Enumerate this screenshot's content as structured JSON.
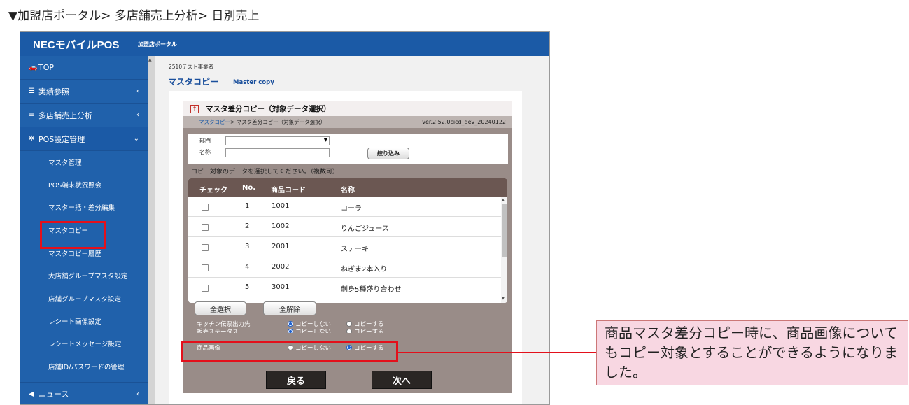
{
  "caption": "▼加盟店ポータル> 多店舗売上分析> 日別売上",
  "app": {
    "brand": "NECモバイルPOS",
    "brand_sub": "加盟店ポータル"
  },
  "sidebar": {
    "top_items": [
      {
        "icon": "car-icon",
        "label": "TOP",
        "chevron": ""
      },
      {
        "icon": "list-icon",
        "label": "実績参照",
        "chevron": "‹"
      },
      {
        "icon": "database-icon",
        "label": "多店舗売上分析",
        "chevron": "‹"
      },
      {
        "icon": "gear-icon",
        "label": "POS設定管理",
        "chevron": "⌄"
      }
    ],
    "sub_items": [
      "マスタ管理",
      "POS端末状況照会",
      "マスター括・差分編集",
      "マスタコピー",
      "マスタコピー履歴",
      "大店舗グループマスタ設定",
      "店舗グループマスタ設定",
      "レシート画像設定",
      "レシートメッセージ設定",
      "店舗ID/パスワードの管理"
    ],
    "bottom_item": {
      "icon": "megaphone-icon",
      "label": "ニュース",
      "chevron": "‹"
    }
  },
  "content": {
    "company": "2510テスト事業者",
    "page_title": "マスタコピー",
    "page_title_en": "Master copy"
  },
  "dialog": {
    "title": "マスタ差分コピー（対象データ選択）",
    "breadcrumb_link": "マスタコピー",
    "breadcrumb_rest": " > マスタ差分コピー（対象データ選択）",
    "version": "ver.2.52.0cicd_dev_20240122",
    "filter": {
      "dept_label": "部門",
      "name_label": "名称",
      "dept_value": "",
      "name_value": "",
      "search_button": "絞り込み"
    },
    "select_note": "コピー対象のデータを選択してください。（複数可）",
    "table": {
      "headers": [
        "チェック",
        "No.",
        "商品コード",
        "名称"
      ],
      "rows": [
        {
          "no": "1",
          "code": "1001",
          "name": "コーラ"
        },
        {
          "no": "2",
          "code": "1002",
          "name": "りんごジュース"
        },
        {
          "no": "3",
          "code": "2001",
          "name": "ステーキ"
        },
        {
          "no": "4",
          "code": "2002",
          "name": "ねぎま2本入り"
        },
        {
          "no": "5",
          "code": "3001",
          "name": "刺身5種盛り合わせ"
        }
      ]
    },
    "select_all": "全選択",
    "clear_all": "全解除",
    "options": [
      {
        "label": "キッチン伝票出力先",
        "no_copy": "コピーしない",
        "copy": "コピーする",
        "selected": "no_copy"
      },
      {
        "label": "販売ステータス",
        "no_copy": "コピーしない",
        "copy": "コピーする",
        "selected": "no_copy"
      },
      {
        "label": "商品画像",
        "no_copy": "コピーしない",
        "copy": "コピーする",
        "selected": "copy"
      }
    ],
    "back_button": "戻る",
    "next_button": "次へ"
  },
  "callout": "商品マスタ差分コピー時に、商品画像についてもコピー対象とすることができるようになりました。",
  "colors": {
    "header_blue": "#1b5aa6",
    "sidebar_blue": "#2061ab",
    "highlight_red": "#e3101b",
    "callout_pink": "#f8d7e2",
    "dialog_brown": "#998c88"
  }
}
